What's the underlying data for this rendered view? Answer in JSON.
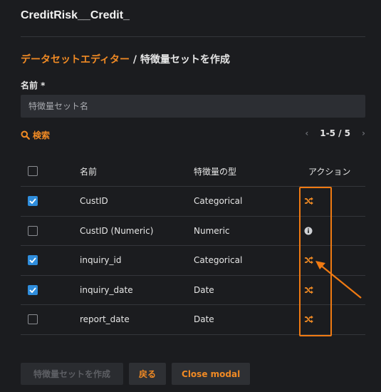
{
  "modal": {
    "title": "CreditRisk__Credit_"
  },
  "breadcrumb": {
    "parent": "データセットエディター",
    "separator": " / ",
    "current": "特徴量セットを作成"
  },
  "form": {
    "name_label": "名前 *",
    "name_placeholder": "特徴量セット名",
    "name_value": ""
  },
  "search": {
    "label": "検索"
  },
  "pagination": {
    "prev": "‹",
    "range": "1-5 / 5",
    "next": "›"
  },
  "table": {
    "headers": {
      "name": "名前",
      "type": "特徴量の型",
      "action": "アクション"
    },
    "rows": [
      {
        "checked": true,
        "name": "CustID",
        "type": "Categorical",
        "action_icon": "shuffle-icon"
      },
      {
        "checked": false,
        "name": "CustID (Numeric)",
        "type": "Numeric",
        "action_icon": "info-icon"
      },
      {
        "checked": true,
        "name": "inquiry_id",
        "type": "Categorical",
        "action_icon": "shuffle-icon"
      },
      {
        "checked": true,
        "name": "inquiry_date",
        "type": "Date",
        "action_icon": "shuffle-icon"
      },
      {
        "checked": false,
        "name": "report_date",
        "type": "Date",
        "action_icon": "shuffle-icon"
      }
    ]
  },
  "footer": {
    "create_label": "特徴量セットを作成",
    "back_label": "戻る",
    "close_label": "Close modal"
  },
  "colors": {
    "accent": "#f08a24",
    "annotation": "#f07a12",
    "checkbox": "#2f8ddc",
    "background": "#1b1c1f"
  }
}
